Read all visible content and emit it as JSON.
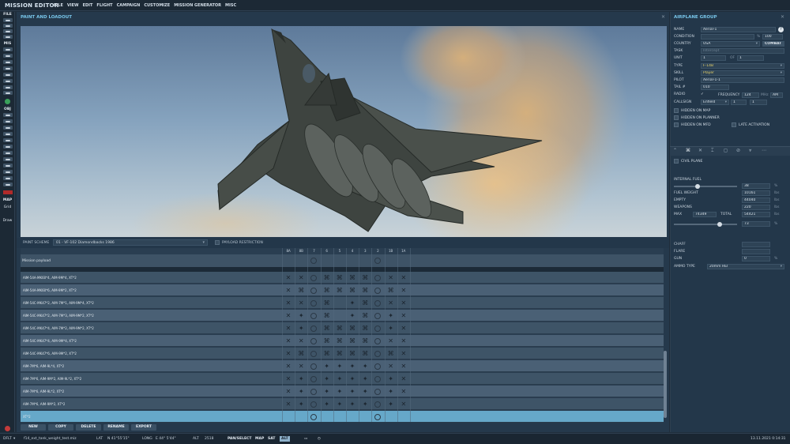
{
  "app": {
    "title": "MISSION EDITOR",
    "menu": [
      "FILE",
      "VIEW",
      "EDIT",
      "FLIGHT",
      "CAMPAIGN",
      "CUSTOMIZE",
      "MISSION GENERATOR",
      "MISC"
    ]
  },
  "toolbar": {
    "groups": [
      "FILE",
      "MIS",
      "OBJ",
      "MAP"
    ],
    "map_buttons": [
      "Grid",
      "Draw"
    ]
  },
  "paint_panel": {
    "title": "PAINT AND LOADOUT",
    "scheme_label": "PAINT SCHEME",
    "scheme_value": "01 - VF-102 Diamondbacks 1986",
    "payload_restriction_label": "PAYLOAD RESTRICTION"
  },
  "pylons": [
    "8A",
    "8B",
    "7",
    "6",
    "5",
    "4",
    "3",
    "2",
    "1B",
    "1A"
  ],
  "mission_payload_label": "Mission payload",
  "loadouts": [
    {
      "name": "AIM-54A-MK60*4, AIM-9M*4, XT*2",
      "marks": [
        "x",
        "x",
        "o",
        "z",
        "z",
        "z",
        "z",
        "o",
        "x",
        "x"
      ]
    },
    {
      "name": "AIM-54A-MK60*6, AIM-9M*2, XT*2",
      "marks": [
        "x",
        "z",
        "o",
        "z",
        "z",
        "z",
        "z",
        "o",
        "z",
        "x"
      ]
    },
    {
      "name": "AIM-54C-MK47*2, AIM-7M*1, AIM-9M*4, XT*2",
      "marks": [
        "x",
        "x",
        "o",
        "z",
        "",
        "+",
        "z",
        "o",
        "x",
        "x"
      ]
    },
    {
      "name": "AIM-54C-MK47*2, AIM-7M*3, AIM-9M*2, XT*2",
      "marks": [
        "x",
        "+",
        "o",
        "z",
        "",
        "+",
        "z",
        "o",
        "+",
        "x"
      ]
    },
    {
      "name": "AIM-54C-MK47*4, AIM-7M*2, AIM-9M*2, XT*2",
      "marks": [
        "x",
        "+",
        "o",
        "z",
        "z",
        "z",
        "z",
        "o",
        "+",
        "x"
      ]
    },
    {
      "name": "AIM-54C-MK47*4, AIM-9M*4, XT*2",
      "marks": [
        "x",
        "x",
        "o",
        "z",
        "z",
        "z",
        "z",
        "o",
        "x",
        "x"
      ]
    },
    {
      "name": "AIM-54C-MK47*6, AIM-9M*2, XT*2",
      "marks": [
        "x",
        "z",
        "o",
        "z",
        "z",
        "z",
        "z",
        "o",
        "z",
        "x"
      ]
    },
    {
      "name": "AIM-7M*6, AIM-9L*4, XT*2",
      "marks": [
        "x",
        "x",
        "o",
        "+",
        "+",
        "+",
        "+",
        "o",
        "x",
        "x"
      ]
    },
    {
      "name": "AIM-7M*6, AIM-9M*2, AIM-9L*2, XT*2",
      "marks": [
        "x",
        "+",
        "o",
        "+",
        "+",
        "+",
        "+",
        "o",
        "+",
        "x"
      ]
    },
    {
      "name": "AIM-7M*6, AIM-9L*2, XT*2",
      "marks": [
        "x",
        "+",
        "o",
        "+",
        "+",
        "+",
        "+",
        "o",
        "+",
        "x"
      ]
    },
    {
      "name": "AIM-7M*6, AIM-9M*2, XT*2",
      "marks": [
        "x",
        "+",
        "o",
        "+",
        "+",
        "+",
        "+",
        "o",
        "+",
        "x"
      ]
    },
    {
      "name": "XT*2",
      "marks": [
        "",
        "",
        "o",
        "",
        "",
        "",
        "",
        "o",
        "",
        ""
      ]
    }
  ],
  "bottom_buttons": [
    "NEW",
    "COPY",
    "DELETE",
    "RENAME",
    "EXPORT"
  ],
  "status": {
    "mode": "DFLT",
    "file": "f14_ext_tank_weight_test.miz",
    "lat_label": "LAT",
    "lat": "N 41°55'15\"",
    "long_label": "LONG",
    "long": "E 44° 5'44\"",
    "alt_label": "ALT",
    "alt": "2518",
    "pan_select": "PAN/SELECT",
    "map_modes": [
      "MAP",
      "SAT",
      "ALT"
    ],
    "datetime": "13.11.2021 0:14:31"
  },
  "airplane_group": {
    "title": "AIRPLANE GROUP",
    "name_label": "NAME",
    "name": "Aerial-1",
    "help": "?",
    "condition_label": "CONDITION",
    "condition_pct": "%",
    "condition_value": "100",
    "country_label": "COUNTRY",
    "country": "USA",
    "combat": "COMBAT",
    "task_label": "TASK",
    "task": "Intercept",
    "unit_label": "UNIT",
    "unit": "1",
    "unit_of": "OF",
    "unit_total": "1",
    "type_label": "TYPE",
    "type": "F-14B",
    "skill_label": "SKILL",
    "skill": "Player",
    "pilot_label": "PILOT",
    "pilot": "Aerial-1-1",
    "tail_label": "TAIL #",
    "tail": "010",
    "radio_label": "RADIO",
    "frequency_label": "FREQUENCY",
    "frequency": "124",
    "freq_unit": "MHz",
    "modulation": "AM",
    "callsign_label": "CALLSIGN",
    "callsign": "Enfield",
    "callsign_a": "1",
    "callsign_b": "1",
    "hidden_map": "HIDDEN ON MAP",
    "hidden_planner": "HIDDEN ON PLANNER",
    "hidden_mfd": "HIDDEN ON MFD",
    "late_activation": "LATE ACTIVATION",
    "civil_plane": "CIVIL PLANE"
  },
  "fuel": {
    "internal_fuel_label": "INTERNAL FUEL",
    "internal_fuel": "38",
    "internal_fuel_level": 0.38,
    "fuel_weight_label": "FUEL WEIGHT",
    "fuel_weight": "10161",
    "empty_label": "EMPTY",
    "empty": "44040",
    "weapons_label": "WEAPONS",
    "weapons": "220",
    "max_label": "MAX",
    "max": "74349",
    "total_label": "TOTAL",
    "total": "54421",
    "total_pct": "73",
    "total_level": 0.73,
    "unit_lbs": "lbs",
    "unit_pct": "%"
  },
  "countermeasures": {
    "chaff_label": "CHAFF",
    "flare_label": "FLARE",
    "gun_label": "GUN",
    "gun": "0",
    "ammo_type_label": "AMMO TYPE",
    "ammo_type": "20mm HEI"
  }
}
